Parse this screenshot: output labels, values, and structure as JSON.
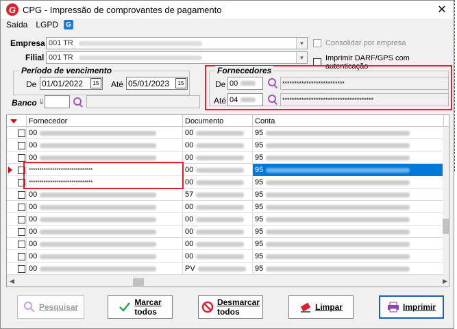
{
  "window": {
    "title": "CPG - Impressão de comprovantes de pagamento",
    "logo_letter": "G",
    "close_glyph": "✕"
  },
  "menu": {
    "items": [
      "Saída",
      "LGPD"
    ],
    "icon_letter": "G"
  },
  "filters": {
    "empresa_label": "Empresa",
    "empresa_value": "001 TR",
    "filial_label": "Filial",
    "filial_value": "001 TR",
    "consolidar_label": "Consolidar por empresa",
    "imprimir_darf_label": "Imprimir DARF/GPS com autenticação"
  },
  "periodo": {
    "title": "Período de vencimento",
    "de_label": "De",
    "de_value": "01/01/2022",
    "ate_label": "Até",
    "ate_value": "05/01/2023",
    "cal_glyph": "15"
  },
  "fornecedores": {
    "title": "Fornecedores",
    "de_label": "De",
    "de_code": "00",
    "de_name": "**************************",
    "ate_label": "Até",
    "ate_code": "04",
    "ate_name": "**************************************"
  },
  "banco": {
    "label": "Banco"
  },
  "grid": {
    "columns": [
      "Fornecedor",
      "Documento",
      "Conta"
    ],
    "rows": [
      {
        "fornecedor": "00",
        "documento": "00",
        "conta": "95",
        "selected": false,
        "current": false
      },
      {
        "fornecedor": "00",
        "documento": "00",
        "conta": "95",
        "selected": false,
        "current": false
      },
      {
        "fornecedor": "00",
        "documento": "00",
        "conta": "95",
        "selected": false,
        "current": false
      },
      {
        "fornecedor": "******************************",
        "documento": "00",
        "conta": "95",
        "selected": true,
        "current": true
      },
      {
        "fornecedor": "******************************",
        "documento": "00",
        "conta": "95",
        "selected": false,
        "current": false
      },
      {
        "fornecedor": "00",
        "documento": "57",
        "conta": "95",
        "selected": false,
        "current": false
      },
      {
        "fornecedor": "00",
        "documento": "00",
        "conta": "95",
        "selected": false,
        "current": false
      },
      {
        "fornecedor": "00",
        "documento": "00",
        "conta": "95",
        "selected": false,
        "current": false
      },
      {
        "fornecedor": "00",
        "documento": "00",
        "conta": "95",
        "selected": false,
        "current": false
      },
      {
        "fornecedor": "00",
        "documento": "00",
        "conta": "95",
        "selected": false,
        "current": false
      },
      {
        "fornecedor": "00",
        "documento": "00",
        "conta": "95",
        "selected": false,
        "current": false
      },
      {
        "fornecedor": "00",
        "documento": "PV",
        "conta": "95",
        "selected": false,
        "current": false
      }
    ]
  },
  "buttons": {
    "pesquisar": "Pesquisar",
    "marcar_1": "Marcar",
    "marcar_2": "todos",
    "desmarcar_1": "Desmarcar",
    "desmarcar_2": "todos",
    "limpar": "Limpar",
    "imprimir": "Imprimir"
  },
  "colors": {
    "selection": "#0078d7",
    "highlight_box": "#e02030",
    "brand": "#d9232e",
    "search_icon": "#9b59b6"
  }
}
